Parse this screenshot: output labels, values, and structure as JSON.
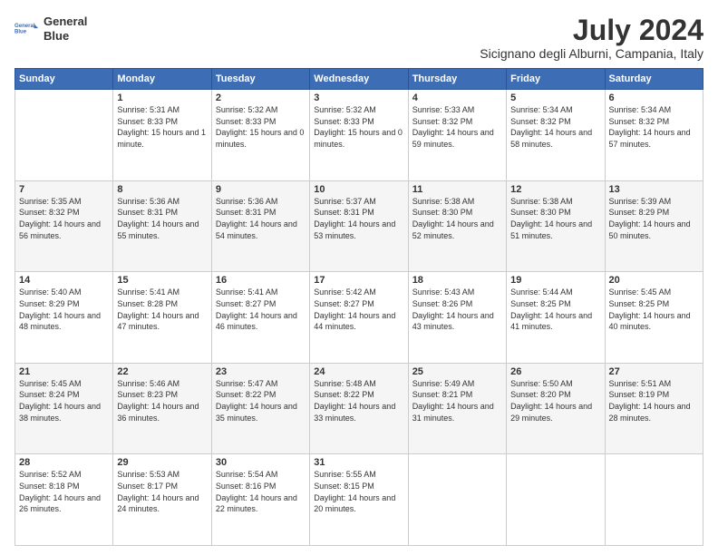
{
  "header": {
    "logo_line1": "General",
    "logo_line2": "Blue",
    "month": "July 2024",
    "location": "Sicignano degli Alburni, Campania, Italy"
  },
  "weekdays": [
    "Sunday",
    "Monday",
    "Tuesday",
    "Wednesday",
    "Thursday",
    "Friday",
    "Saturday"
  ],
  "weeks": [
    [
      {
        "day": "",
        "sunrise": "",
        "sunset": "",
        "daylight": ""
      },
      {
        "day": "1",
        "sunrise": "Sunrise: 5:31 AM",
        "sunset": "Sunset: 8:33 PM",
        "daylight": "Daylight: 15 hours and 1 minute."
      },
      {
        "day": "2",
        "sunrise": "Sunrise: 5:32 AM",
        "sunset": "Sunset: 8:33 PM",
        "daylight": "Daylight: 15 hours and 0 minutes."
      },
      {
        "day": "3",
        "sunrise": "Sunrise: 5:32 AM",
        "sunset": "Sunset: 8:33 PM",
        "daylight": "Daylight: 15 hours and 0 minutes."
      },
      {
        "day": "4",
        "sunrise": "Sunrise: 5:33 AM",
        "sunset": "Sunset: 8:32 PM",
        "daylight": "Daylight: 14 hours and 59 minutes."
      },
      {
        "day": "5",
        "sunrise": "Sunrise: 5:34 AM",
        "sunset": "Sunset: 8:32 PM",
        "daylight": "Daylight: 14 hours and 58 minutes."
      },
      {
        "day": "6",
        "sunrise": "Sunrise: 5:34 AM",
        "sunset": "Sunset: 8:32 PM",
        "daylight": "Daylight: 14 hours and 57 minutes."
      }
    ],
    [
      {
        "day": "7",
        "sunrise": "Sunrise: 5:35 AM",
        "sunset": "Sunset: 8:32 PM",
        "daylight": "Daylight: 14 hours and 56 minutes."
      },
      {
        "day": "8",
        "sunrise": "Sunrise: 5:36 AM",
        "sunset": "Sunset: 8:31 PM",
        "daylight": "Daylight: 14 hours and 55 minutes."
      },
      {
        "day": "9",
        "sunrise": "Sunrise: 5:36 AM",
        "sunset": "Sunset: 8:31 PM",
        "daylight": "Daylight: 14 hours and 54 minutes."
      },
      {
        "day": "10",
        "sunrise": "Sunrise: 5:37 AM",
        "sunset": "Sunset: 8:31 PM",
        "daylight": "Daylight: 14 hours and 53 minutes."
      },
      {
        "day": "11",
        "sunrise": "Sunrise: 5:38 AM",
        "sunset": "Sunset: 8:30 PM",
        "daylight": "Daylight: 14 hours and 52 minutes."
      },
      {
        "day": "12",
        "sunrise": "Sunrise: 5:38 AM",
        "sunset": "Sunset: 8:30 PM",
        "daylight": "Daylight: 14 hours and 51 minutes."
      },
      {
        "day": "13",
        "sunrise": "Sunrise: 5:39 AM",
        "sunset": "Sunset: 8:29 PM",
        "daylight": "Daylight: 14 hours and 50 minutes."
      }
    ],
    [
      {
        "day": "14",
        "sunrise": "Sunrise: 5:40 AM",
        "sunset": "Sunset: 8:29 PM",
        "daylight": "Daylight: 14 hours and 48 minutes."
      },
      {
        "day": "15",
        "sunrise": "Sunrise: 5:41 AM",
        "sunset": "Sunset: 8:28 PM",
        "daylight": "Daylight: 14 hours and 47 minutes."
      },
      {
        "day": "16",
        "sunrise": "Sunrise: 5:41 AM",
        "sunset": "Sunset: 8:27 PM",
        "daylight": "Daylight: 14 hours and 46 minutes."
      },
      {
        "day": "17",
        "sunrise": "Sunrise: 5:42 AM",
        "sunset": "Sunset: 8:27 PM",
        "daylight": "Daylight: 14 hours and 44 minutes."
      },
      {
        "day": "18",
        "sunrise": "Sunrise: 5:43 AM",
        "sunset": "Sunset: 8:26 PM",
        "daylight": "Daylight: 14 hours and 43 minutes."
      },
      {
        "day": "19",
        "sunrise": "Sunrise: 5:44 AM",
        "sunset": "Sunset: 8:25 PM",
        "daylight": "Daylight: 14 hours and 41 minutes."
      },
      {
        "day": "20",
        "sunrise": "Sunrise: 5:45 AM",
        "sunset": "Sunset: 8:25 PM",
        "daylight": "Daylight: 14 hours and 40 minutes."
      }
    ],
    [
      {
        "day": "21",
        "sunrise": "Sunrise: 5:45 AM",
        "sunset": "Sunset: 8:24 PM",
        "daylight": "Daylight: 14 hours and 38 minutes."
      },
      {
        "day": "22",
        "sunrise": "Sunrise: 5:46 AM",
        "sunset": "Sunset: 8:23 PM",
        "daylight": "Daylight: 14 hours and 36 minutes."
      },
      {
        "day": "23",
        "sunrise": "Sunrise: 5:47 AM",
        "sunset": "Sunset: 8:22 PM",
        "daylight": "Daylight: 14 hours and 35 minutes."
      },
      {
        "day": "24",
        "sunrise": "Sunrise: 5:48 AM",
        "sunset": "Sunset: 8:22 PM",
        "daylight": "Daylight: 14 hours and 33 minutes."
      },
      {
        "day": "25",
        "sunrise": "Sunrise: 5:49 AM",
        "sunset": "Sunset: 8:21 PM",
        "daylight": "Daylight: 14 hours and 31 minutes."
      },
      {
        "day": "26",
        "sunrise": "Sunrise: 5:50 AM",
        "sunset": "Sunset: 8:20 PM",
        "daylight": "Daylight: 14 hours and 29 minutes."
      },
      {
        "day": "27",
        "sunrise": "Sunrise: 5:51 AM",
        "sunset": "Sunset: 8:19 PM",
        "daylight": "Daylight: 14 hours and 28 minutes."
      }
    ],
    [
      {
        "day": "28",
        "sunrise": "Sunrise: 5:52 AM",
        "sunset": "Sunset: 8:18 PM",
        "daylight": "Daylight: 14 hours and 26 minutes."
      },
      {
        "day": "29",
        "sunrise": "Sunrise: 5:53 AM",
        "sunset": "Sunset: 8:17 PM",
        "daylight": "Daylight: 14 hours and 24 minutes."
      },
      {
        "day": "30",
        "sunrise": "Sunrise: 5:54 AM",
        "sunset": "Sunset: 8:16 PM",
        "daylight": "Daylight: 14 hours and 22 minutes."
      },
      {
        "day": "31",
        "sunrise": "Sunrise: 5:55 AM",
        "sunset": "Sunset: 8:15 PM",
        "daylight": "Daylight: 14 hours and 20 minutes."
      },
      {
        "day": "",
        "sunrise": "",
        "sunset": "",
        "daylight": ""
      },
      {
        "day": "",
        "sunrise": "",
        "sunset": "",
        "daylight": ""
      },
      {
        "day": "",
        "sunrise": "",
        "sunset": "",
        "daylight": ""
      }
    ]
  ]
}
